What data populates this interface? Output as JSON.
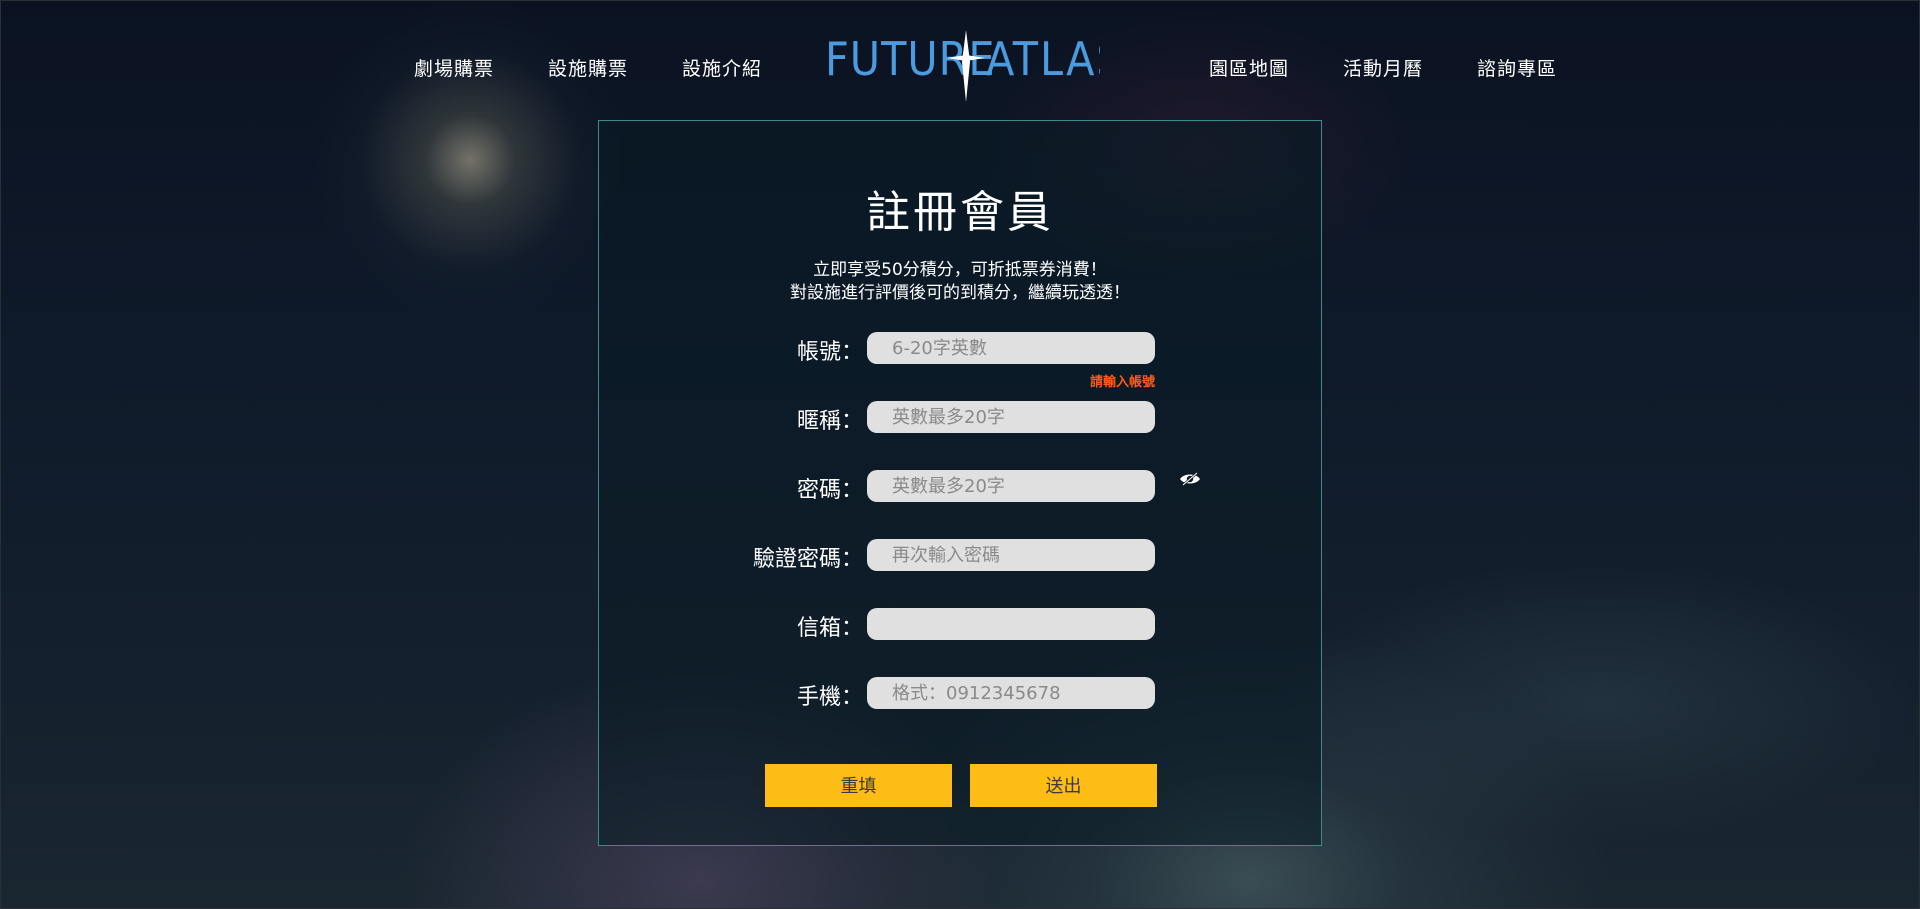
{
  "nav": {
    "left": [
      "劇場購票",
      "設施購票",
      "設施介紹"
    ],
    "right": [
      "園區地圖",
      "活動月曆",
      "諮詢專區"
    ]
  },
  "logo": {
    "left": "FUTURE",
    "right": "ATLAS",
    "color": "#4a9be0"
  },
  "form": {
    "title": "註冊會員",
    "intro_line1": "立即享受50分積分，可折抵票券消費！",
    "intro_line2": "對設施進行評價後可的到積分，繼續玩透透！",
    "fields": [
      {
        "label": "帳號：",
        "placeholder": "6-20字英數",
        "value": ""
      },
      {
        "label": "暱稱：",
        "placeholder": "英數最多20字",
        "value": ""
      },
      {
        "label": "密碼：",
        "placeholder": "英數最多20字",
        "value": ""
      },
      {
        "label": "驗證密碼：",
        "placeholder": "再次輸入密碼",
        "value": ""
      },
      {
        "label": "信箱：",
        "placeholder": "",
        "value": ""
      },
      {
        "label": "手機：",
        "placeholder": "格式：0912345678",
        "value": ""
      }
    ],
    "account_error": "請輸入帳號",
    "password_toggle_icon": "eye-slash-icon",
    "reset_label": "重填",
    "submit_label": "送出"
  },
  "colors": {
    "accent_button": "#fdbd16",
    "card_border": "#3c8a8a",
    "error": "#ff5a1a"
  }
}
